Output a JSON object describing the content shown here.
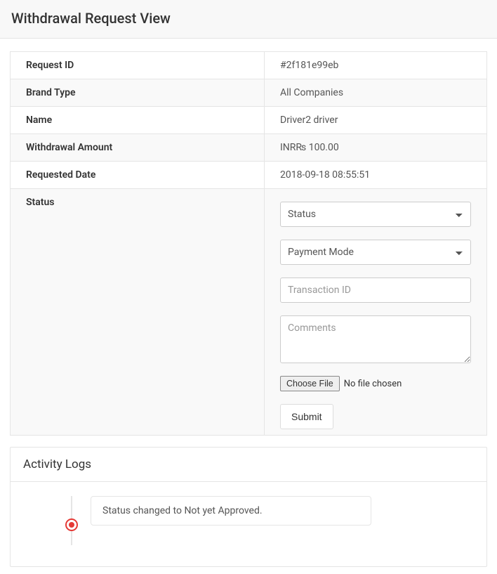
{
  "header": {
    "title": "Withdrawal Request View"
  },
  "details": {
    "request_id": {
      "label": "Request ID",
      "value": "#2f181e99eb"
    },
    "brand_type": {
      "label": "Brand Type",
      "value": "All Companies"
    },
    "name": {
      "label": "Name",
      "value": "Driver2 driver"
    },
    "amount": {
      "label": "Withdrawal Amount",
      "value": "INR₨ 100.00"
    },
    "requested_date": {
      "label": "Requested Date",
      "value": "2018-09-18 08:55:51"
    },
    "status_label": "Status"
  },
  "form": {
    "status_placeholder": "Status",
    "payment_mode_placeholder": "Payment Mode",
    "transaction_id_placeholder": "Transaction ID",
    "comments_placeholder": "Comments",
    "choose_file_label": "Choose File",
    "no_file_label": "No file chosen",
    "submit_label": "Submit"
  },
  "activity": {
    "title": "Activity Logs",
    "items": [
      {
        "text": "Status changed to Not yet Approved."
      }
    ]
  }
}
